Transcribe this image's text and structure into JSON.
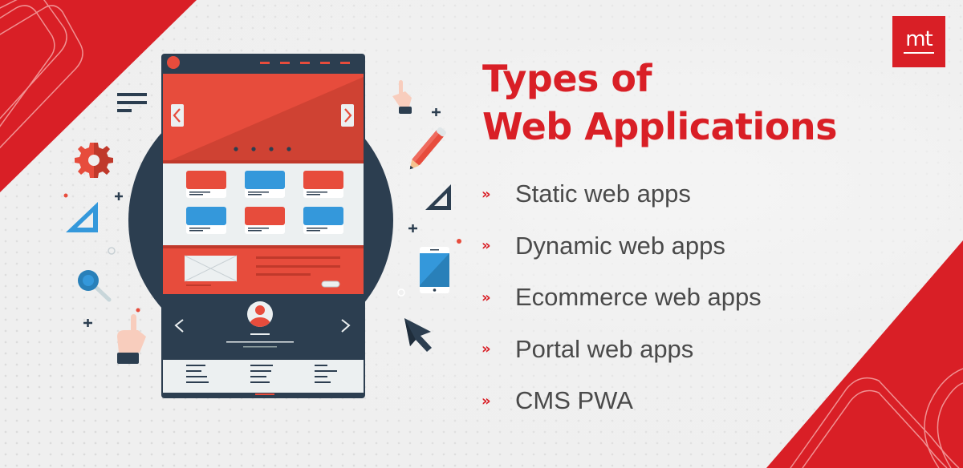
{
  "heading": {
    "line1": "Types of",
    "line2": "Web Applications"
  },
  "logo": {
    "text": "mt"
  },
  "list": {
    "bullet": "»",
    "items": [
      {
        "label": "Static web apps"
      },
      {
        "label": "Dynamic web apps"
      },
      {
        "label": "Ecommerce web apps"
      },
      {
        "label": "Portal web apps"
      },
      {
        "label": "CMS PWA"
      }
    ]
  },
  "colors": {
    "brand_red": "#d91f26",
    "mock_red": "#e74c3c",
    "mock_dark": "#2c3e50",
    "mock_blue": "#3498db",
    "text_gray": "#4a4a4a",
    "background": "#efefef"
  },
  "illustration": {
    "mock_cards": [
      "red",
      "blue",
      "red",
      "blue",
      "red",
      "blue"
    ],
    "slider_dots": 4,
    "decor_icons": [
      "menu-icon",
      "gear-icon",
      "set-square-icon",
      "magnifier-icon",
      "pointing-hand-icon",
      "pencil-icon",
      "triangle-ruler-icon",
      "smartphone-icon",
      "cursor-icon"
    ]
  }
}
